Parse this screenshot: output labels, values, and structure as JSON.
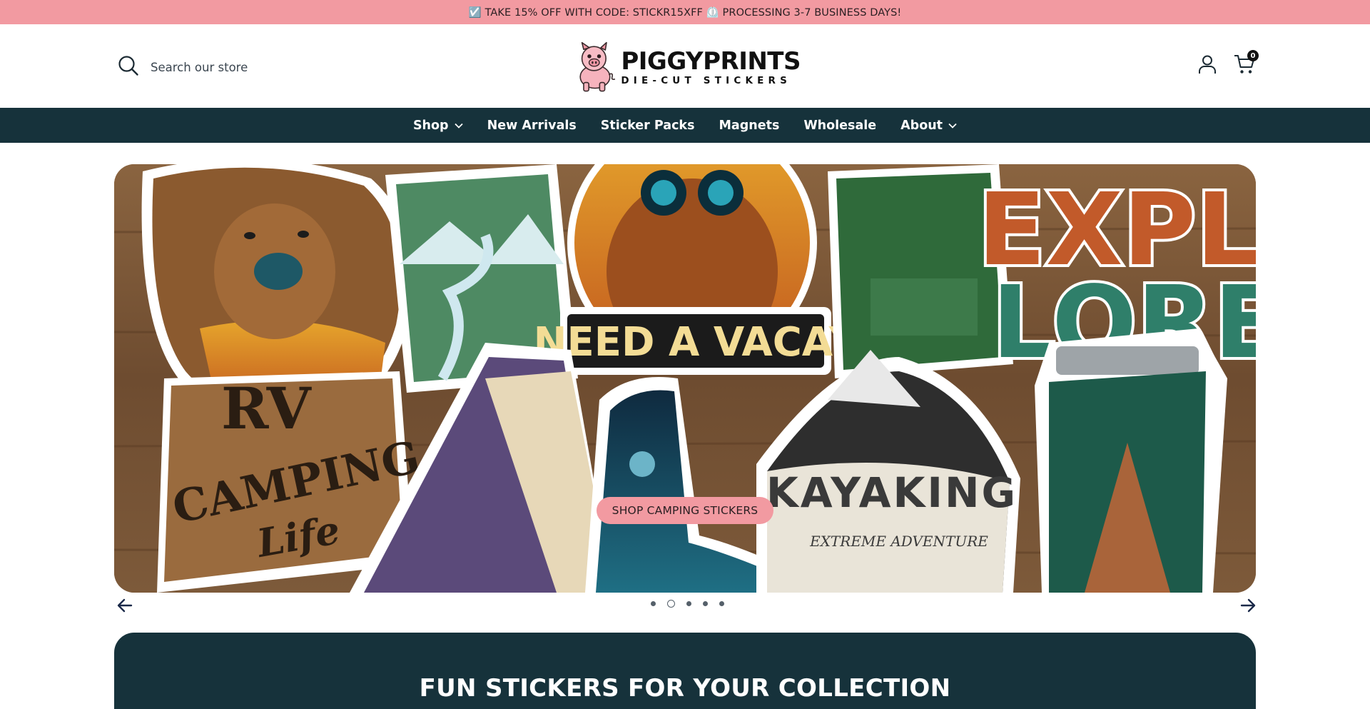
{
  "announcement": "☑️ TAKE 15% OFF WITH CODE: STICKR15XFF ⏲️ PROCESSING 3-7 BUSINESS DAYS!",
  "search": {
    "placeholder": "Search our store"
  },
  "logo": {
    "title": "PIGGYPRINTS",
    "subtitle": "DIE-CUT STICKERS"
  },
  "cart": {
    "count": "0"
  },
  "nav": {
    "items": [
      {
        "label": "Shop",
        "has_dropdown": true
      },
      {
        "label": "New Arrivals",
        "has_dropdown": false
      },
      {
        "label": "Sticker Packs",
        "has_dropdown": false
      },
      {
        "label": "Magnets",
        "has_dropdown": false
      },
      {
        "label": "Wholesale",
        "has_dropdown": false
      },
      {
        "label": "About",
        "has_dropdown": true
      }
    ]
  },
  "hero": {
    "button_label": "SHOP CAMPING STICKERS",
    "sticker_texts": [
      "RV",
      "CAMPING",
      "Life",
      "NEED A VACAY",
      "KAYAKING",
      "EXTREME ADVENTURE",
      "EXPL",
      "LORE"
    ],
    "slide_count": 5,
    "active_slide": 2
  },
  "collection": {
    "heading": "FUN STICKERS FOR YOUR COLLECTION"
  },
  "colors": {
    "announcement_bg": "#f29aa1",
    "nav_bg": "#16323b",
    "button_bg": "#f29aa1"
  },
  "icons": [
    "search-icon",
    "account-icon",
    "cart-icon",
    "chevron-down-icon",
    "arrow-left-icon",
    "arrow-right-icon"
  ]
}
